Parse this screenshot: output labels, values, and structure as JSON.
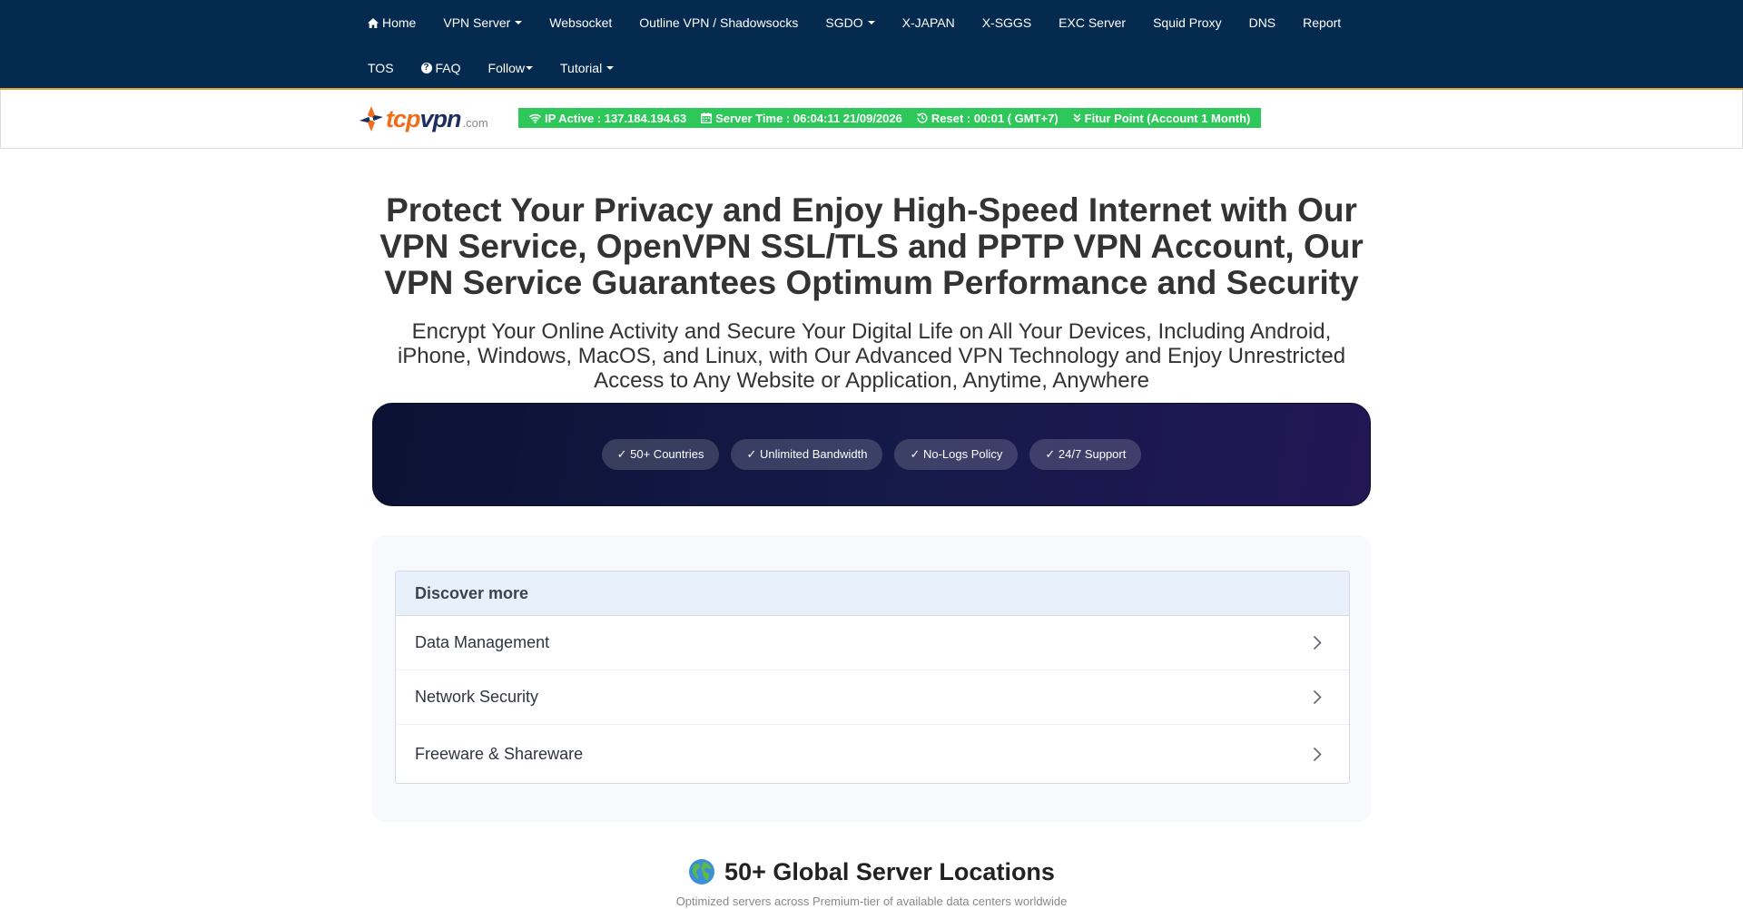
{
  "nav": {
    "row1": [
      {
        "label": "Home",
        "icon": "home-icon",
        "dropdown": false
      },
      {
        "label": "VPN Server",
        "dropdown": true
      },
      {
        "label": "Websocket",
        "dropdown": false
      },
      {
        "label": "Outline VPN / Shadowsocks",
        "dropdown": false
      },
      {
        "label": "SGDO",
        "dropdown": true
      },
      {
        "label": "X-JAPAN",
        "dropdown": false
      },
      {
        "label": "X-SGGS",
        "dropdown": false
      },
      {
        "label": "EXC Server",
        "dropdown": false
      },
      {
        "label": "Squid Proxy",
        "dropdown": false
      },
      {
        "label": "DNS",
        "dropdown": false
      },
      {
        "label": "Report",
        "dropdown": false
      }
    ],
    "row2": [
      {
        "label": "TOS",
        "dropdown": false
      },
      {
        "label": "FAQ",
        "icon": "question-circle-icon",
        "dropdown": false
      },
      {
        "label": "Follow",
        "dropdown": true
      },
      {
        "label": "Tutorial",
        "dropdown": true
      }
    ]
  },
  "logo": {
    "tcp": "tcp",
    "vpn": "vpn",
    "com": ".com"
  },
  "status": {
    "ip": "IP Active : 137.184.194.63",
    "server_time": "Server Time : 06:04:11 21/09/2026",
    "reset": "Reset : 00:01 ( GMT+7)",
    "fitur": "Fitur Point (Account 1 Month)"
  },
  "hero": {
    "title": "Protect Your Privacy and Enjoy High-Speed Internet with Our VPN Service, OpenVPN SSL/TLS and PPTP VPN Account, Our VPN Service Guarantees Optimum Performance and Security",
    "subtitle": "Encrypt Your Online Activity and Secure Your Digital Life on All Your Devices, Including Android, iPhone, Windows, MacOS, and Linux, with Our Advanced VPN Technology and Enjoy Unrestricted Access to Any Website or Application, Anytime, Anywhere"
  },
  "features": [
    "✓ 50+ Countries",
    "✓ Unlimited Bandwidth",
    "✓ No-Logs Policy",
    "✓ 24/7 Support"
  ],
  "discover": {
    "heading": "Discover more",
    "items": [
      "Data Management",
      "Network Security",
      "Freeware & Shareware"
    ]
  },
  "global": {
    "title": "50+ Global Server Locations",
    "subtitle": "Optimized servers across Premium-tier of available data centers worldwide"
  },
  "colors": {
    "navbar": "#052a4f",
    "navbar_border": "#e0a33c",
    "status_green": "#2dc75a",
    "banner_dark": "#141a48",
    "discover_head": "#e8f0fc"
  }
}
